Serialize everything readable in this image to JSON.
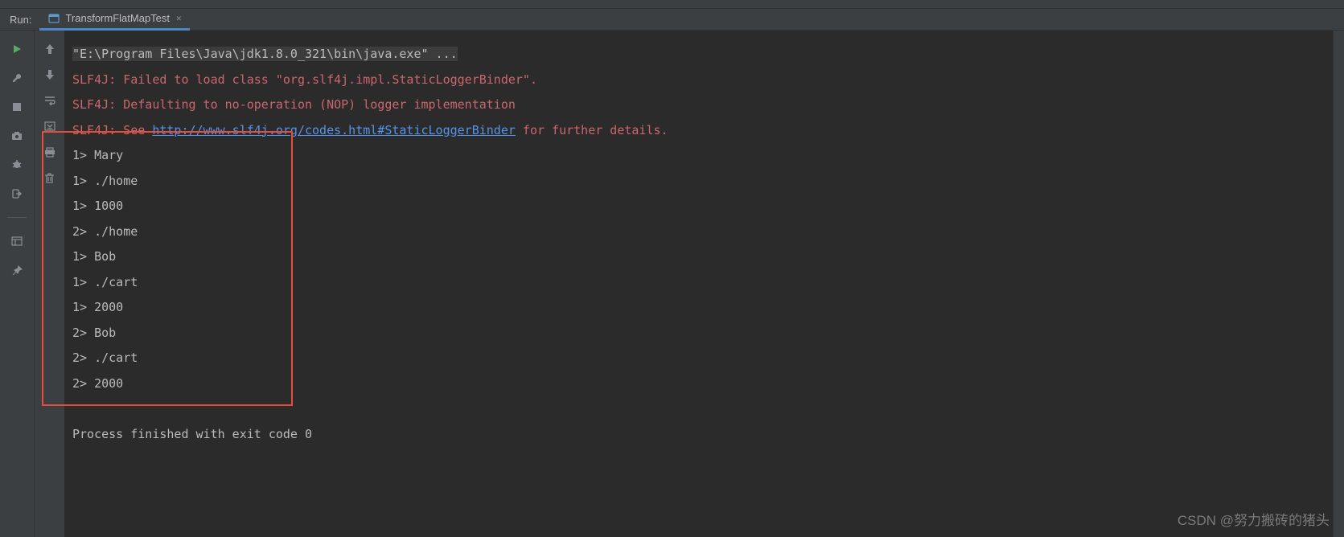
{
  "header": {
    "run_label": "Run:",
    "tab_label": "TransformFlatMapTest"
  },
  "console": {
    "cmd_line": "\"E:\\Program Files\\Java\\jdk1.8.0_321\\bin\\java.exe\" ...",
    "slf4j1_prefix": "SLF4J: Failed to load class \"org.slf4j.impl.StaticLoggerBinder\".",
    "slf4j2": "SLF4J: Defaulting to no-operation (NOP) logger implementation",
    "slf4j3_prefix": "SLF4J: See ",
    "slf4j3_link": "http://www.slf4j.org/codes.html#StaticLoggerBinder",
    "slf4j3_suffix": " for further details.",
    "output_lines": [
      "1> Mary",
      "1> ./home",
      "1> 1000",
      "2> ./home",
      "1> Bob",
      "1> ./cart",
      "1> 2000",
      "2> Bob",
      "2> ./cart",
      "2> 2000"
    ],
    "exit_line": "Process finished with exit code 0"
  },
  "watermark": "CSDN @努力搬砖的猪头"
}
